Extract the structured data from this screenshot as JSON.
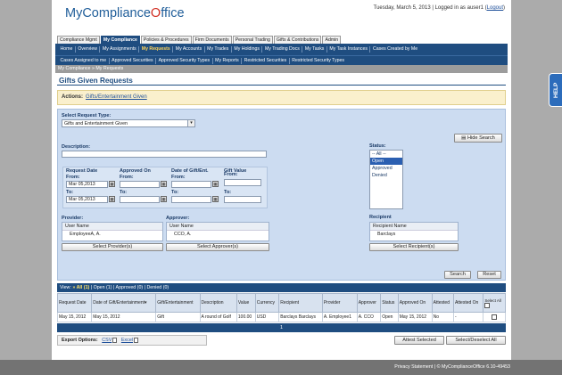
{
  "logo": {
    "brand_a": "MyCompliance",
    "brand_b": "O",
    "brand_c": "ffice"
  },
  "header": {
    "userinfo": "Tuesday, March 5, 2013 | Logged in as ",
    "username": "auser1",
    "logout": "Logout"
  },
  "module_tabs": [
    "Compliance Mgmt",
    "My Compliance",
    "Policies & Procedures",
    "Firm Documents",
    "Personal Trading",
    "Gifts & Contributions",
    "Admin"
  ],
  "nav_row1": [
    "Home",
    "Overview",
    "My Assignments",
    "My Requests",
    "My Accounts",
    "My Trades",
    "My Holdings",
    "My Trading Docs",
    "My Tasks",
    "My Task Instances",
    "Cases Created by Me"
  ],
  "nav_row2": [
    "Cases Assigned to me",
    "Approved Securities",
    "Approved Security Types",
    "My Reports",
    "Restricted Securities",
    "Restricted Security Types"
  ],
  "breadcrumb": "My Compliance » My Requests",
  "page_title": "Gifts Given Requests",
  "actions": {
    "label": "Actions:",
    "link": "Gifts/Entertainment Given"
  },
  "filter": {
    "request_type_label": "Select Request Type:",
    "request_type_value": "Gifts and Entertainment Given",
    "hide_search": "Hide Search",
    "description_label": "Description:",
    "description_value": "",
    "status_label": "Status:",
    "status_options": [
      "-- All --",
      "Open",
      "Approved",
      "Denied"
    ],
    "request_date_label": "Request Date",
    "approved_on_label": "Approved On",
    "gift_date_label": "Date of Gift/Ent.",
    "gift_value_label": "Gift Value",
    "from_label": "From:",
    "to_label": "To:",
    "request_date_from": "Mar 05,2013",
    "request_date_to": "Mar 05,2013",
    "provider_label": "Provider:",
    "approver_label": "Approver:",
    "recipient_label": "Recipient",
    "user_name_header": "User Name",
    "recipient_name_header": "Recipient Name",
    "provider_value": "EmployeeA, A.",
    "approver_value": "CCO, A.",
    "recipient_value": "Barclays",
    "select_provider": "Select Provider(s)",
    "select_approver": "Select Approver(s)",
    "select_recipient": "Select Recipient(s)",
    "search": "Search",
    "reset": "Reset"
  },
  "viewbar": {
    "prefix": "View: ",
    "all": "» All (1)",
    "rest": " | Open (1) | Approved (0) | Denied (0)"
  },
  "table": {
    "headers": [
      "Request Date",
      "Date of Gift/Entertainment",
      "Gift/Entertainment",
      "Description",
      "Value",
      "Currency",
      "Recipient",
      "Provider",
      "Approver",
      "Status",
      "Approved On",
      "Attested",
      "Attested On",
      "Select All"
    ],
    "rows": [
      [
        "May 15, 2012",
        "May 15, 2012",
        "Gift",
        "A round of Golf",
        "100.00",
        "USD",
        "Barclays Barclays",
        "A. Employee1",
        "A. CCO",
        "Open",
        "May 15, 2012",
        "No",
        "-"
      ]
    ]
  },
  "pager": "1",
  "export": {
    "label": "Export Options:",
    "csv": "CSV",
    "excel": "Excel"
  },
  "bottom_buttons": {
    "attest": "Attest Selected",
    "select_all": "Select/Deselect All"
  },
  "footer": "Privacy Statement  |  © MyComplianceOffice 6.10-49453",
  "help": "HELP"
}
